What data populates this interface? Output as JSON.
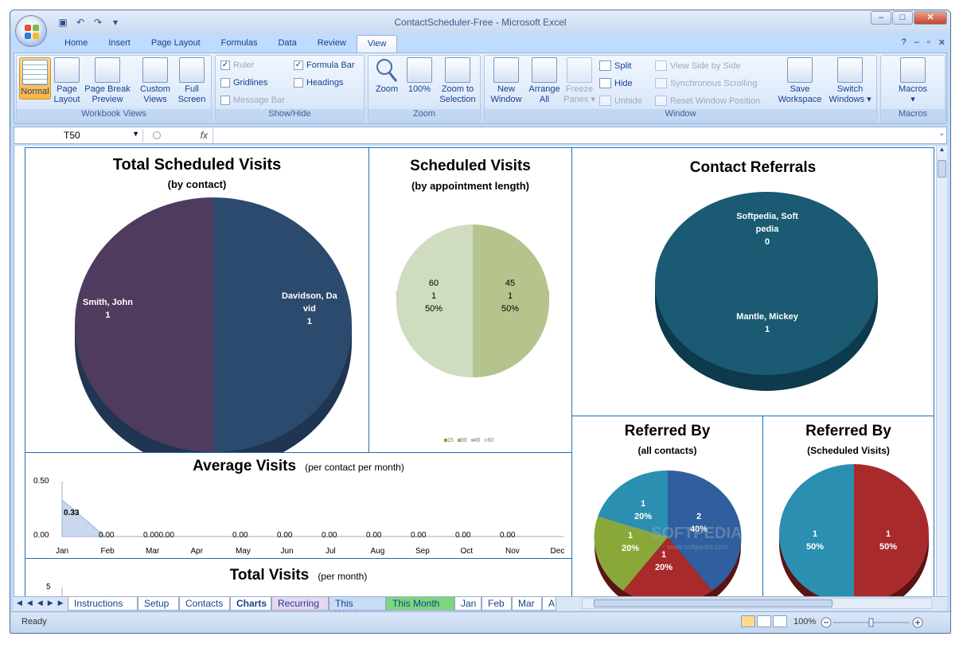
{
  "window": {
    "title": "ContactScheduler-Free - Microsoft Excel"
  },
  "ribbon_tabs": [
    "Home",
    "Insert",
    "Page Layout",
    "Formulas",
    "Data",
    "Review",
    "View"
  ],
  "active_tab": "View",
  "groups": {
    "workbook_views": {
      "label": "Workbook Views",
      "normal": "Normal",
      "page_layout": [
        "Page",
        "Layout"
      ],
      "page_break": [
        "Page Break",
        "Preview"
      ],
      "custom_views": [
        "Custom",
        "Views"
      ],
      "full_screen": [
        "Full",
        "Screen"
      ]
    },
    "show_hide": {
      "label": "Show/Hide",
      "ruler": "Ruler",
      "gridlines": "Gridlines",
      "message_bar": "Message Bar",
      "formula_bar": "Formula Bar",
      "headings": "Headings"
    },
    "zoom": {
      "label": "Zoom",
      "zoom": "Zoom",
      "hundred": "100%",
      "zoom_sel": [
        "Zoom to",
        "Selection"
      ]
    },
    "window": {
      "label": "Window",
      "new_window": [
        "New",
        "Window"
      ],
      "arrange_all": [
        "Arrange",
        "All"
      ],
      "freeze": [
        "Freeze",
        "Panes"
      ],
      "split": "Split",
      "hide": "Hide",
      "unhide": "Unhide",
      "side_by_side": "View Side by Side",
      "sync_scroll": "Synchronous Scrolling",
      "reset_pos": "Reset Window Position",
      "save_ws": [
        "Save",
        "Workspace"
      ],
      "switch_win": [
        "Switch",
        "Windows"
      ]
    },
    "macros": {
      "label": "Macros",
      "macros": "Macros"
    }
  },
  "formula_bar": {
    "name_box": "T50",
    "fx": "fx"
  },
  "charts": {
    "total_scheduled": {
      "title": "Total Scheduled Visits",
      "subtitle": "(by contact)",
      "slices": [
        {
          "label": "Smith, John",
          "value": "1"
        },
        {
          "label": "Davidson, Da",
          "label2": "vid",
          "value": "1"
        }
      ]
    },
    "scheduled_len": {
      "title": "Scheduled Visits",
      "subtitle": "(by appointment length)",
      "slices": [
        {
          "a": "60",
          "b": "1",
          "c": "50%"
        },
        {
          "a": "45",
          "b": "1",
          "c": "50%"
        }
      ],
      "legend": [
        "15",
        "30",
        "45",
        "60"
      ]
    },
    "contact_referrals": {
      "title": "Contact Referrals",
      "slices": [
        {
          "label": "Softpedia, Soft",
          "label2": "pedia",
          "value": "0"
        },
        {
          "label": "Mantle, Mickey",
          "value": "1"
        }
      ]
    },
    "average_visits": {
      "title": "Average Visits",
      "subtitle": "(per  contact per month)",
      "yticks": [
        "0.50",
        "0.00"
      ],
      "months": [
        "Jan",
        "Feb",
        "Mar",
        "Apr",
        "May",
        "Jun",
        "Jul",
        "Aug",
        "Sep",
        "Oct",
        "Nov",
        "Dec"
      ],
      "labels": [
        "0.33",
        "0.00",
        "0.000.00",
        "0.00",
        "0.00",
        "0.00",
        "0.00",
        "0.00",
        "0.00",
        "0.00"
      ]
    },
    "total_visits": {
      "title": "Total Visits",
      "subtitle": "(per month)",
      "ytick": "5"
    },
    "referred_all": {
      "title": "Referred By",
      "subtitle": "(all contacts)",
      "slices": [
        {
          "v": "1",
          "p": "20%"
        },
        {
          "v": "2",
          "p": "40%"
        },
        {
          "v": "1",
          "p": "20%"
        },
        {
          "v": "1",
          "p": "20%"
        }
      ]
    },
    "referred_sched": {
      "title": "Referred By",
      "subtitle": "(Scheduled Visits)",
      "slices": [
        {
          "v": "1",
          "p": "50%"
        },
        {
          "v": "1",
          "p": "50%"
        }
      ]
    }
  },
  "chart_data": [
    {
      "type": "pie",
      "title": "Total Scheduled Visits",
      "subtitle": "(by contact)",
      "categories": [
        "Smith, John",
        "Davidson, David"
      ],
      "values": [
        1,
        1
      ]
    },
    {
      "type": "pie",
      "title": "Scheduled Visits",
      "subtitle": "(by appointment length)",
      "categories": [
        "60",
        "45"
      ],
      "values": [
        1,
        1
      ],
      "percent": [
        50,
        50
      ],
      "legend": [
        "15",
        "30",
        "45",
        "60"
      ]
    },
    {
      "type": "pie",
      "title": "Contact Referrals",
      "categories": [
        "Softpedia, Softpedia",
        "Mantle, Mickey"
      ],
      "values": [
        0,
        1
      ]
    },
    {
      "type": "area",
      "title": "Average Visits",
      "subtitle": "(per  contact per month)",
      "categories": [
        "Jan",
        "Feb",
        "Mar",
        "Apr",
        "May",
        "Jun",
        "Jul",
        "Aug",
        "Sep",
        "Oct",
        "Nov",
        "Dec"
      ],
      "values": [
        0.33,
        0,
        0,
        0,
        0,
        0,
        0,
        0,
        0,
        0,
        0,
        0
      ],
      "ylim": [
        0,
        0.5
      ]
    },
    {
      "type": "pie",
      "title": "Referred By",
      "subtitle": "(all contacts)",
      "values": [
        1,
        2,
        1,
        1
      ],
      "percent": [
        20,
        40,
        20,
        20
      ]
    },
    {
      "type": "pie",
      "title": "Referred By",
      "subtitle": "(Scheduled Visits)",
      "values": [
        1,
        1
      ],
      "percent": [
        50,
        50
      ]
    }
  ],
  "sheet_tabs": [
    "Instructions",
    "Setup",
    "Contacts",
    "Charts",
    "Recurring",
    "This Week",
    "This Month",
    "Jan",
    "Feb",
    "Mar",
    "A"
  ],
  "active_sheet": "Charts",
  "status": {
    "ready": "Ready",
    "zoom": "100%"
  },
  "watermark": {
    "text": "SOFTPEDIA",
    "url": "www.softpedia.com"
  }
}
